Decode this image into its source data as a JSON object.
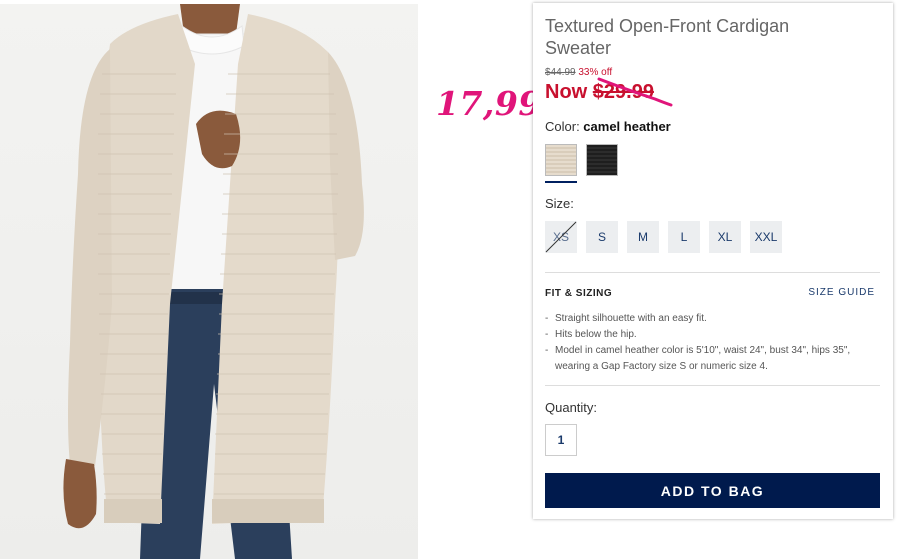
{
  "product": {
    "title": "Textured Open-Front Cardigan Sweater",
    "price_original": "$44.99",
    "price_discount": "33% off",
    "price_now_prefix": "Now ",
    "price_now": "$29.99",
    "markup_price": "17,99"
  },
  "color": {
    "label": "Color: ",
    "selected": "camel heather",
    "swatches": [
      "camel heather",
      "black"
    ]
  },
  "size": {
    "label": "Size:",
    "options": [
      "XS",
      "S",
      "M",
      "L",
      "XL",
      "XXL"
    ]
  },
  "fit": {
    "heading": "FIT & SIZING",
    "guide_link": "SIZE GUIDE",
    "bullets": [
      "Straight silhouette with an easy fit.",
      "Hits below the hip.",
      "Model in camel heather color is 5'10\", waist 24\", bust 34\", hips 35\", wearing a Gap Factory size S or numeric size 4."
    ]
  },
  "quantity": {
    "label": "Quantity:",
    "value": "1"
  },
  "cart": {
    "add_label": "ADD TO BAG"
  },
  "colors": {
    "accent_navy": "#001a4d",
    "sale_red": "#c8102e",
    "markup_pink": "#e0157a"
  }
}
